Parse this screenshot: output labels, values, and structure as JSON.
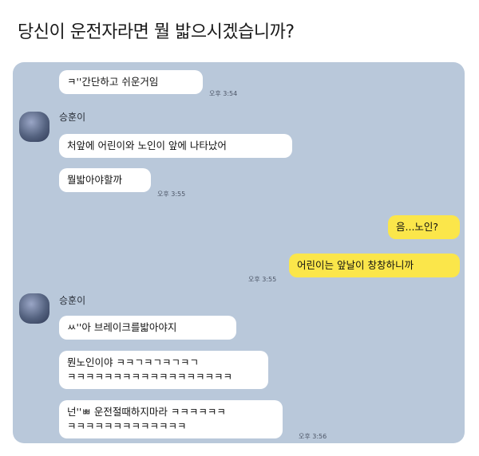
{
  "title": "당신이 운전자라면 뭘 밟으시겠습니까?",
  "messages": {
    "m0": {
      "text": "ㅋ''간단하고 쉬운거임",
      "time": "오후 3:54"
    },
    "sender1": "승훈이",
    "m1": {
      "text": "처앞에 어린이와 노인이 앞에 나타났어"
    },
    "m2": {
      "text": "뭘밟아야할까",
      "time": "오후 3:55"
    },
    "m3": {
      "text": "음...노인?"
    },
    "m4": {
      "text": "어린이는 앞날이 창창하니까",
      "time": "오후 3:55"
    },
    "sender2": "승훈이",
    "m5": {
      "text": "ㅆ''아 브레이크를밟아야지"
    },
    "m6": {
      "line1": "뭔노인이야 ㅋㅋㄱㅋㄱㅋㄱㅋㄱ",
      "line2": "ㅋㅋㅋㅋㅋㅋㅋㅋㅋㅋㅋㅋㅋㅋㅋㅋㅋㅋ"
    },
    "m7": {
      "line1": "넌''ㅃ 운전절때하지마라 ㅋㅋㅋㅋㅋㅋ",
      "line2": "ㅋㅋㅋㅋㅋㅋㅋㅋㅋㅋㅋㅋㅋ",
      "time": "오후 3:56"
    }
  },
  "colors": {
    "chat_background": "#b9c8da",
    "my_bubble": "#fbe64a",
    "other_bubble": "#ffffff"
  }
}
